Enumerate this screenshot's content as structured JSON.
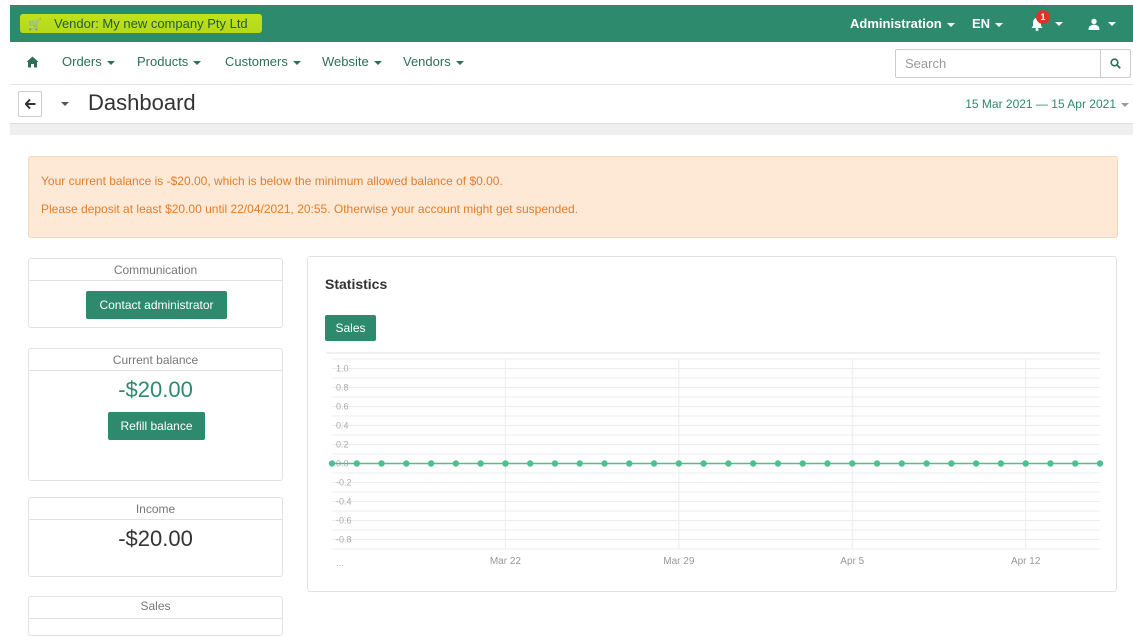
{
  "topbar": {
    "vendor_label": "Vendor: My new company Pty Ltd",
    "admin_label": "Administration",
    "lang_label": "EN",
    "notifications_count": "1"
  },
  "menu": {
    "items": [
      {
        "label": "Orders"
      },
      {
        "label": "Products"
      },
      {
        "label": "Customers"
      },
      {
        "label": "Website"
      },
      {
        "label": "Vendors"
      }
    ],
    "search_placeholder": "Search"
  },
  "header": {
    "title": "Dashboard",
    "date_range": "15 Mar 2021 — 15 Apr 2021"
  },
  "alert": {
    "line1": "Your current balance is -$20.00, which is below the minimum allowed balance of $0.00.",
    "line2": "Please deposit at least $20.00 until 22/04/2021, 20:55. Otherwise your account might get suspended."
  },
  "cards": {
    "communication": {
      "title": "Communication",
      "button": "Contact administrator"
    },
    "balance": {
      "title": "Current balance",
      "value": "-$20.00",
      "button": "Refill balance"
    },
    "income": {
      "title": "Income",
      "value": "-$20.00"
    },
    "sales": {
      "title": "Sales"
    }
  },
  "statistics": {
    "title": "Statistics",
    "tab_label": "Sales"
  },
  "colors": {
    "brand": "#2d8a6d",
    "alert_bg": "#fde9d6",
    "alert_text": "#e27d2a",
    "line": "#4fc08d"
  },
  "chart_data": {
    "type": "line",
    "x_start_label": "...",
    "x_ticks": [
      "Mar 22",
      "Mar 29",
      "Apr 5",
      "Apr 12"
    ],
    "y_ticks": [
      "1.0",
      "0.8",
      "0.6",
      "0.4",
      "0.2",
      "0.0",
      "-0.2",
      "-0.4",
      "-0.6",
      "-0.8"
    ],
    "ylim": [
      -0.9,
      1.1
    ],
    "x": [
      "Mar 15",
      "Mar 16",
      "Mar 17",
      "Mar 18",
      "Mar 19",
      "Mar 20",
      "Mar 21",
      "Mar 22",
      "Mar 23",
      "Mar 24",
      "Mar 25",
      "Mar 26",
      "Mar 27",
      "Mar 28",
      "Mar 29",
      "Mar 30",
      "Mar 31",
      "Apr 1",
      "Apr 2",
      "Apr 3",
      "Apr 4",
      "Apr 5",
      "Apr 6",
      "Apr 7",
      "Apr 8",
      "Apr 9",
      "Apr 10",
      "Apr 11",
      "Apr 12",
      "Apr 13",
      "Apr 14",
      "Apr 15"
    ],
    "values": [
      0,
      0,
      0,
      0,
      0,
      0,
      0,
      0,
      0,
      0,
      0,
      0,
      0,
      0,
      0,
      0,
      0,
      0,
      0,
      0,
      0,
      0,
      0,
      0,
      0,
      0,
      0,
      0,
      0,
      0,
      0,
      0
    ],
    "grid": true
  }
}
